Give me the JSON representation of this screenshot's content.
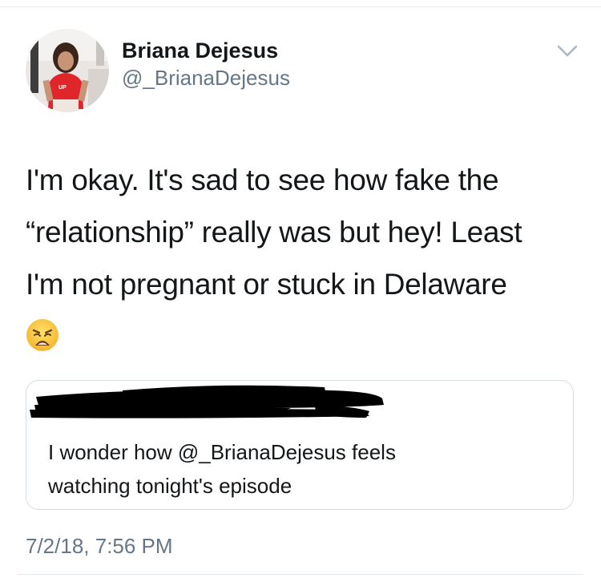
{
  "author": {
    "display_name": "Briana Dejesus",
    "handle": "@_BrianaDejesus",
    "avatar_icon": "profile-photo"
  },
  "tweet": {
    "lines": [
      "I'm okay. It's sad to see how fake the",
      "“relationship” really was but hey! Least",
      "I'm not pregnant or stuck in Delaware"
    ],
    "emoji_icon": "weary-face-emoji"
  },
  "quoted_tweet": {
    "author_redacted": true,
    "lines": [
      "I wonder how @_BrianaDejesus feels",
      "watching tonight's episode"
    ]
  },
  "timestamp": "7/2/18, 7:56 PM",
  "colors": {
    "text": "#14171a",
    "secondary": "#657786",
    "border": "#d6dde3"
  }
}
